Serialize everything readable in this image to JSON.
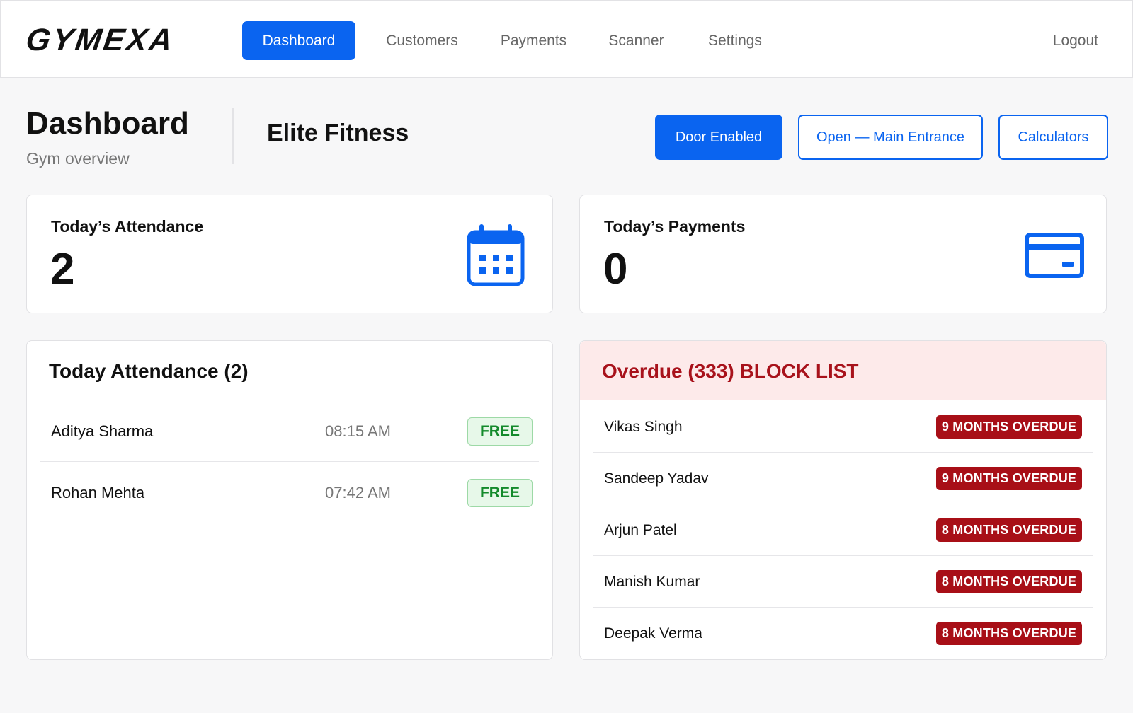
{
  "header": {
    "logo": "GYMEXA",
    "nav": [
      {
        "label": "Dashboard",
        "active": true
      },
      {
        "label": "Customers"
      },
      {
        "label": "Payments"
      },
      {
        "label": "Scanner"
      },
      {
        "label": "Settings"
      }
    ],
    "logout_label": "Logout"
  },
  "page": {
    "title": "Dashboard",
    "subtitle": "Gym overview",
    "gym_name": "Elite Fitness",
    "actions": {
      "door": "Door Enabled",
      "open": "Open — Main Entrance",
      "calculators": "Calculators"
    }
  },
  "stats": {
    "attendance": {
      "label": "Today’s Attendance",
      "value": "2",
      "icon": "calendar-icon"
    },
    "payments": {
      "label": "Today’s Payments",
      "value": "0",
      "icon": "credit-card-icon"
    }
  },
  "attendance_panel": {
    "title": "Today Attendance (2)",
    "rows": [
      {
        "name": "Aditya Sharma",
        "time": "08:15 AM",
        "status": "FREE"
      },
      {
        "name": "Rohan Mehta",
        "time": "07:42 AM",
        "status": "FREE"
      }
    ]
  },
  "overdue_panel": {
    "title": "Overdue (333) BLOCK LIST",
    "rows": [
      {
        "name": "Vikas Singh",
        "status": "9 MONTHS OVERDUE"
      },
      {
        "name": "Sandeep Yadav",
        "status": "9 MONTHS OVERDUE"
      },
      {
        "name": "Arjun Patel",
        "status": "8 MONTHS OVERDUE"
      },
      {
        "name": "Manish Kumar",
        "status": "8 MONTHS OVERDUE"
      },
      {
        "name": "Deepak Verma",
        "status": "8 MONTHS OVERDUE"
      }
    ]
  },
  "colors": {
    "primary": "#0a64f0",
    "danger": "#a80f17",
    "success": "#138a2b",
    "danger_bg": "#fdeaea"
  }
}
